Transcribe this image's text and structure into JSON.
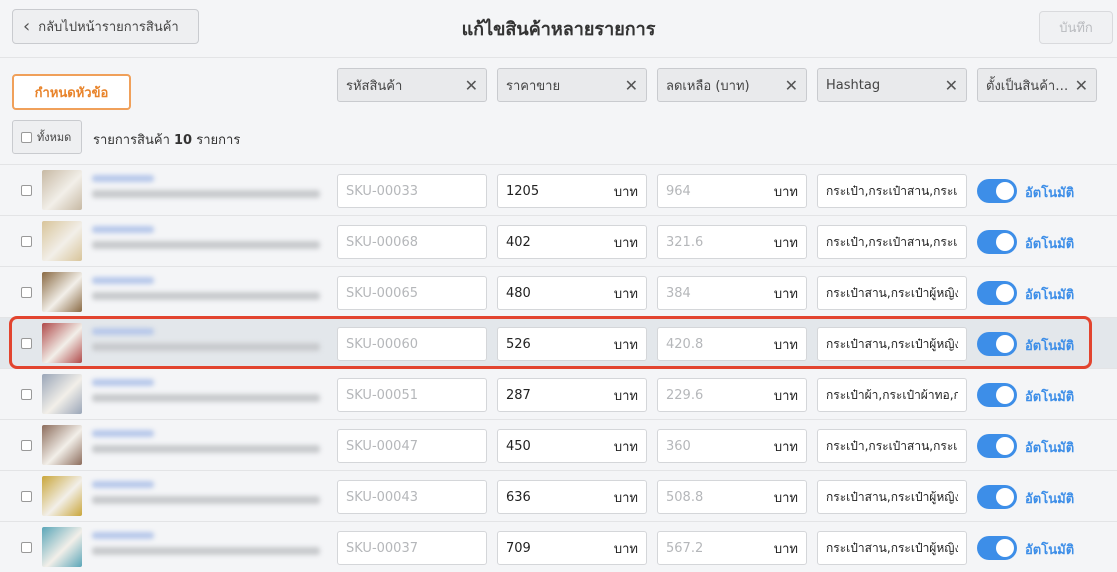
{
  "header": {
    "back_label": "กลับไปหน้ารายการสินค้า",
    "title": "แก้ไขสินค้าหลายรายการ",
    "save_label": "บันทึก"
  },
  "toolbar": {
    "set_columns_label": "กำหนดหัวข้อ",
    "columns": [
      {
        "label": "รหัสสินค้า"
      },
      {
        "label": "ราคาขาย"
      },
      {
        "label": "ลดเหลือ (บาท)"
      },
      {
        "label": "Hashtag"
      },
      {
        "label": "ตั้งเป็นสินค้าขายดี"
      }
    ],
    "select_all_label": "ทั้งหมด",
    "items_prefix": "รายการสินค้า",
    "items_count": "10",
    "items_suffix": "รายการ"
  },
  "unit": "บาท",
  "auto_label": "อัตโนมัติ",
  "colors": {
    "accent_orange": "#e8832a",
    "toggle_blue": "#3d8ee8",
    "highlight_red": "#e2442f"
  },
  "rows": [
    {
      "sku": "SKU-00033",
      "price": "1205",
      "discount": "964",
      "tags": "กระเป๋า,กระเป๋าสาน,กระเป๋า",
      "thumb": "#c7b9a4"
    },
    {
      "sku": "SKU-00068",
      "price": "402",
      "discount": "321.6",
      "tags": "กระเป๋า,กระเป๋าสาน,กระเป๋า",
      "thumb": "#d8c49a"
    },
    {
      "sku": "SKU-00065",
      "price": "480",
      "discount": "384",
      "tags": "กระเป๋าสาน,กระเป๋าผู้หญิง",
      "thumb": "#8a6a44"
    },
    {
      "sku": "SKU-00060",
      "price": "526",
      "discount": "420.8",
      "tags": "กระเป๋าสาน,กระเป๋าผู้หญิง",
      "thumb": "#b04a4a"
    },
    {
      "sku": "SKU-00051",
      "price": "287",
      "discount": "229.6",
      "tags": "กระเป๋าผ้า,กระเป๋าผ้าทอ,กระ",
      "thumb": "#9aa6b8"
    },
    {
      "sku": "SKU-00047",
      "price": "450",
      "discount": "360",
      "tags": "กระเป๋า,กระเป๋าสาน,กระเป๋า",
      "thumb": "#8c6c5c"
    },
    {
      "sku": "SKU-00043",
      "price": "636",
      "discount": "508.8",
      "tags": "กระเป๋าสาน,กระเป๋าผู้หญิง",
      "thumb": "#c9a63a"
    },
    {
      "sku": "SKU-00037",
      "price": "709",
      "discount": "567.2",
      "tags": "กระเป๋าสาน,กระเป๋าผู้หญิง",
      "thumb": "#5aa6b8"
    }
  ]
}
